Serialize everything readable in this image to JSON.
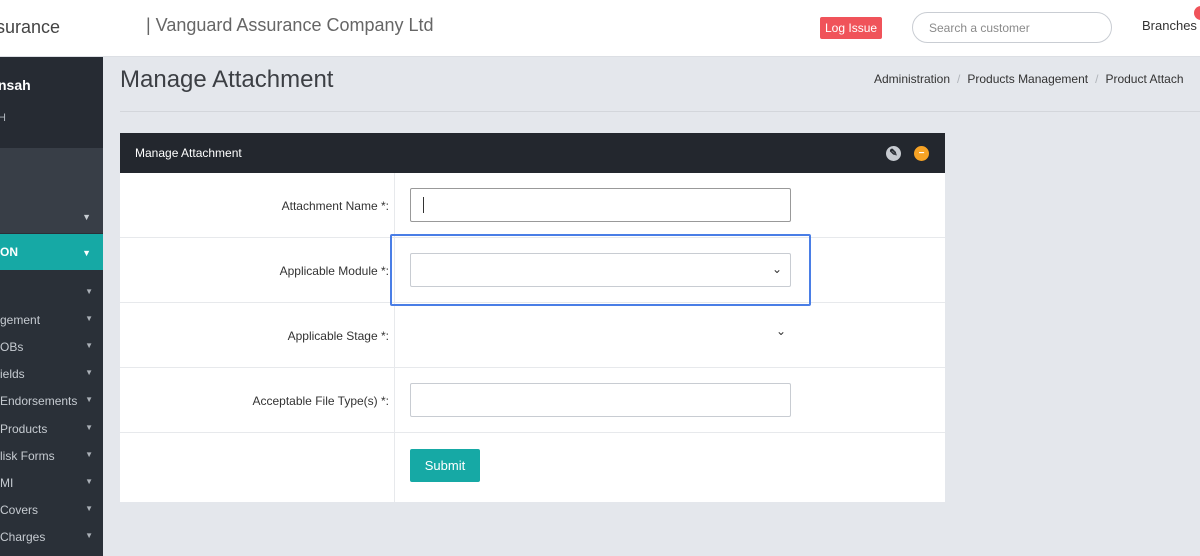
{
  "header": {
    "brand": "surance",
    "company": "| Vanguard Assurance Company Ltd",
    "log_issue": "Log Issue",
    "search_placeholder": "Search a customer",
    "branches": "Branches"
  },
  "sidebar": {
    "user_name": "nsah",
    "user_sub": "H",
    "active_section": "ON",
    "items": [
      {
        "label": ""
      },
      {
        "label": "gement"
      },
      {
        "label": "OBs"
      },
      {
        "label": "ields"
      },
      {
        "label": "Endorsements"
      },
      {
        "label": "Products"
      },
      {
        "label": "lisk Forms"
      },
      {
        "label": "MI"
      },
      {
        "label": "Covers"
      },
      {
        "label": "Charges"
      }
    ]
  },
  "page": {
    "title": "Manage Attachment",
    "breadcrumb": [
      "Administration",
      "Products Management",
      "Product Attach"
    ]
  },
  "panel": {
    "title": "Manage Attachment",
    "fields": {
      "attachment_name": {
        "label": "Attachment Name *:",
        "value": ""
      },
      "applicable_module": {
        "label": "Applicable Module *:",
        "value": ""
      },
      "applicable_stage": {
        "label": "Applicable Stage *:",
        "value": ""
      },
      "file_types": {
        "label": "Acceptable File Type(s) *:",
        "value": ""
      }
    },
    "submit": "Submit"
  },
  "colors": {
    "accent": "#16a9a5",
    "log_issue": "#f0535a",
    "panel_header": "#23272e",
    "focus_outline": "#4a7ee6"
  }
}
